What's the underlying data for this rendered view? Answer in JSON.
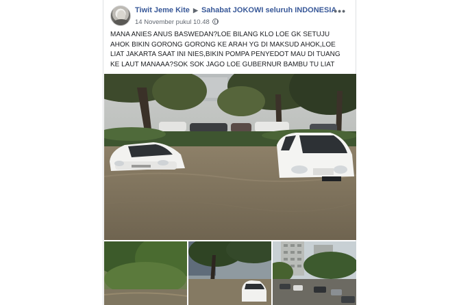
{
  "post": {
    "author": "Tiwit Jeme Kite",
    "group": "Sahabat JOKOWI seluruh INDONESIA",
    "timestamp": "14 November pukul 10.48",
    "lines": [
      "MANA ANIES ANUS BASWEDAN?LOE BILANG KLO LOE GK SETUJU",
      "AHOK BIKIN GORONG GORONG KE ARAH YG DI MAKSUD AHOK,LOE",
      "LIAT JAKARTA SAAT INI NIES,BIKIN POMPA PENYEDOT MAU DI TUANG",
      "KE LAUT MANAAA?SOK SOK JAGO LOE GUBERNUR BAMBU TU LIAT"
    ],
    "more_label": "•••",
    "plate": "B 1340 SAK"
  },
  "icons": {
    "avatar": "profile-photo",
    "arrow": "right-triangle-icon",
    "privacy": "globe-icon",
    "menu": "more-options-icon"
  },
  "colors": {
    "link": "#385898",
    "meta": "#616770",
    "flood_water": "#8a7b63"
  }
}
